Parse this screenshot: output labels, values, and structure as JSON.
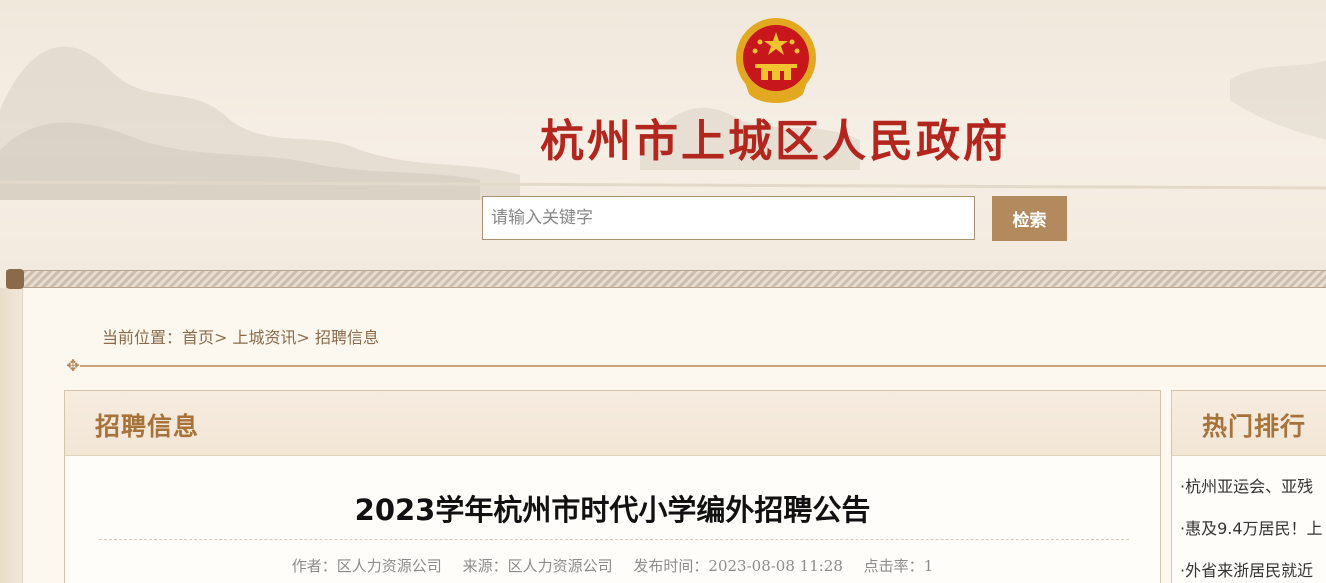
{
  "header": {
    "site_title": "杭州市上城区人民政府",
    "search_placeholder": "请输入关键字",
    "search_button": "检索"
  },
  "breadcrumb": {
    "prefix": "当前位置：",
    "items": [
      "首页",
      "上城资讯",
      "招聘信息"
    ],
    "separator": ">"
  },
  "main": {
    "section_title": "招聘信息",
    "article_title": "2023学年杭州市时代小学编外招聘公告",
    "meta": {
      "author_label": "作者：",
      "author": "区人力资源公司",
      "source_label": "来源：",
      "source": "区人力资源公司",
      "date_label": "发布时间：",
      "date": "2023-08-08 11:28",
      "hits_label": "点击率：",
      "hits": "1"
    }
  },
  "sidebar": {
    "title": "热门排行",
    "items": [
      "·杭州亚运会、亚残",
      "·惠及9.4万居民！上",
      "·外省来浙居民就近"
    ]
  },
  "colors": {
    "title_red": "#b3261e",
    "accent_brown": "#a8733b",
    "button_bg": "#b38a5e",
    "emblem_red": "#c8161d",
    "emblem_gold": "#f2c230"
  }
}
